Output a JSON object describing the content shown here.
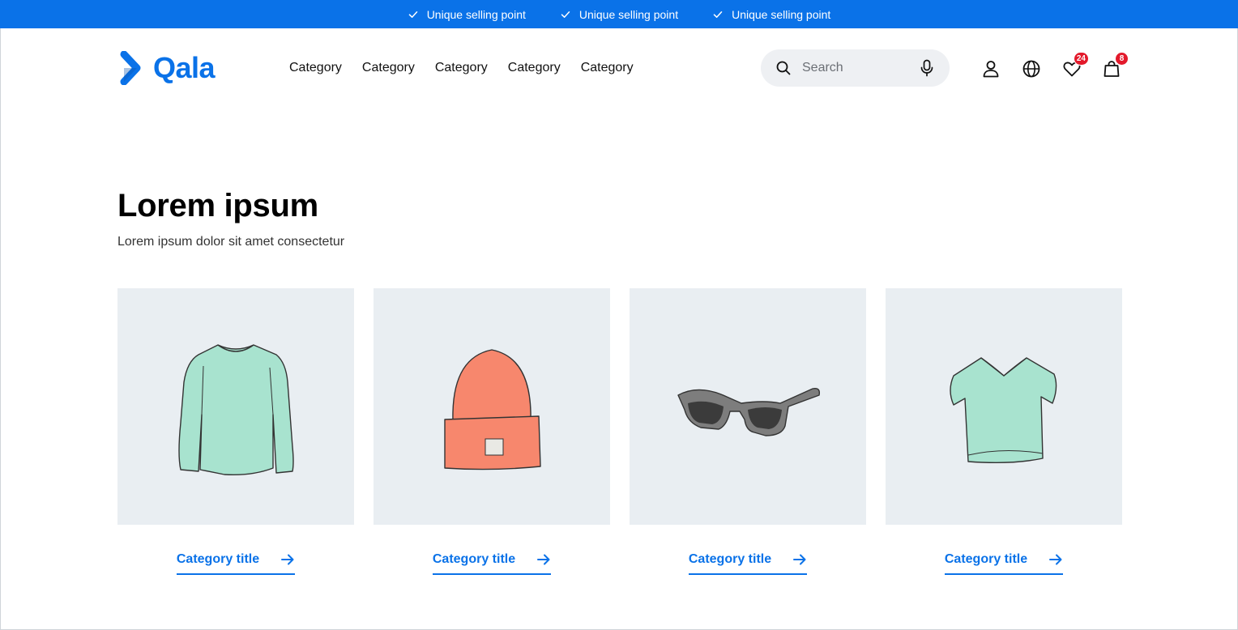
{
  "usp": {
    "items": [
      {
        "label": "Unique selling point",
        "icon": "check-icon"
      },
      {
        "label": "Unique selling point",
        "icon": "check-icon"
      },
      {
        "label": "Unique selling point",
        "icon": "check-icon"
      }
    ]
  },
  "brand": {
    "name": "Qala",
    "color": "#0a72e8"
  },
  "nav": {
    "items": [
      "Category",
      "Category",
      "Category",
      "Category",
      "Category"
    ]
  },
  "search": {
    "placeholder": "Search",
    "value": ""
  },
  "header_icons": {
    "account": "user-icon",
    "language": "globe-icon",
    "wishlist": "heart-icon",
    "wishlist_count": "24",
    "cart": "bag-icon",
    "cart_count": "8",
    "badge_color": "#e3192b"
  },
  "hero": {
    "title": "Lorem ipsum",
    "subtitle": "Lorem ipsum dolor sit amet consectetur"
  },
  "categories": [
    {
      "title": "Category title",
      "image": "long-sleeve-shirt-illustration"
    },
    {
      "title": "Category title",
      "image": "beanie-hat-illustration"
    },
    {
      "title": "Category title",
      "image": "sunglasses-illustration"
    },
    {
      "title": "Category title",
      "image": "tshirt-illustration"
    }
  ]
}
